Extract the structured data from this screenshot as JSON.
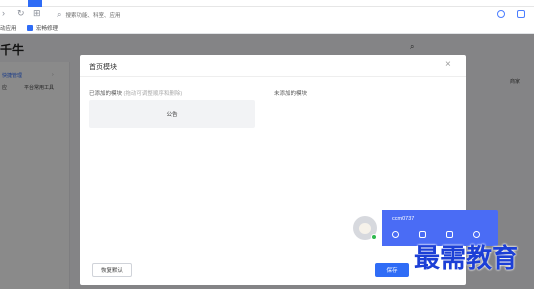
{
  "browser": {
    "search_placeholder": "搜索功能、科室、应用",
    "bookmarks": [
      "动应用",
      "宏畅修理"
    ]
  },
  "page": {
    "app_title": "千牛",
    "sidebar": {
      "item_active": "快捷管理",
      "item_a": "应",
      "item_b": "平台常用工具"
    },
    "right_label": "商家"
  },
  "modal": {
    "title": "首页模块",
    "added_label": "已添加的模块",
    "added_hint": "(拖动可调整顺序和删除)",
    "unadded_label": "未添加的模块",
    "card_label": "公告",
    "restore_button": "恢复默认",
    "save_button": "保存"
  },
  "widget": {
    "username": "ccm0737"
  },
  "watermark": "最需教育",
  "colors": {
    "accent": "#2f6cf6",
    "widget_bg": "#4a6cf5",
    "watermark": "#1c3fd6"
  }
}
